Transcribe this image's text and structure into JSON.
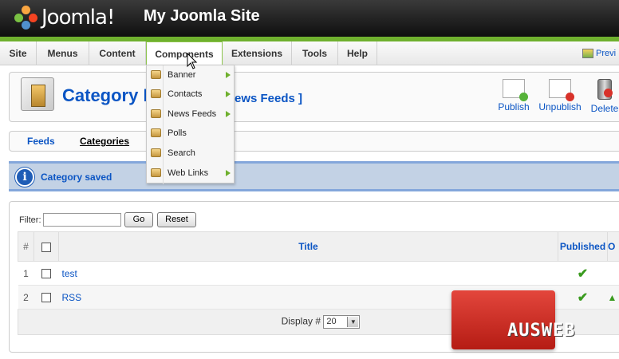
{
  "header": {
    "logo_text": "Joomla!",
    "site_name": "My Joomla Site"
  },
  "menubar": {
    "items": [
      {
        "label": "Site"
      },
      {
        "label": "Menus"
      },
      {
        "label": "Content"
      },
      {
        "label": "Components",
        "active": true
      },
      {
        "label": "Extensions"
      },
      {
        "label": "Tools"
      },
      {
        "label": "Help"
      }
    ],
    "preview_label": "Previ"
  },
  "components_menu": {
    "items": [
      {
        "label": "Banner",
        "has_submenu": true
      },
      {
        "label": "Contacts",
        "has_submenu": true
      },
      {
        "label": "News Feeds",
        "has_submenu": true
      },
      {
        "label": "Polls",
        "has_submenu": false
      },
      {
        "label": "Search",
        "has_submenu": false
      },
      {
        "label": "Web Links",
        "has_submenu": true
      }
    ]
  },
  "toolbar": {
    "title_start": "Category M",
    "title_end": "ews Feeds ]",
    "publish_label": "Publish",
    "unpublish_label": "Unpublish",
    "delete_label": "Delete"
  },
  "submenu": {
    "feeds_label": "Feeds",
    "categories_label": "Categories"
  },
  "message": {
    "text": "Category saved"
  },
  "filter": {
    "label": "Filter:",
    "value": "",
    "go_label": "Go",
    "reset_label": "Reset"
  },
  "table": {
    "col_num": "#",
    "col_title": "Title",
    "col_published": "Published",
    "col_order": "O",
    "rows": [
      {
        "num": "1",
        "title": "test",
        "published": true
      },
      {
        "num": "2",
        "title": "RSS",
        "published": true
      }
    ],
    "display_label": "Display #",
    "display_value": "20"
  },
  "watermark": {
    "text": "AUSWEB"
  },
  "colors": {
    "accent_green": "#6fb02e",
    "link_blue": "#0b55c4",
    "message_bg": "#c3d2e5"
  }
}
